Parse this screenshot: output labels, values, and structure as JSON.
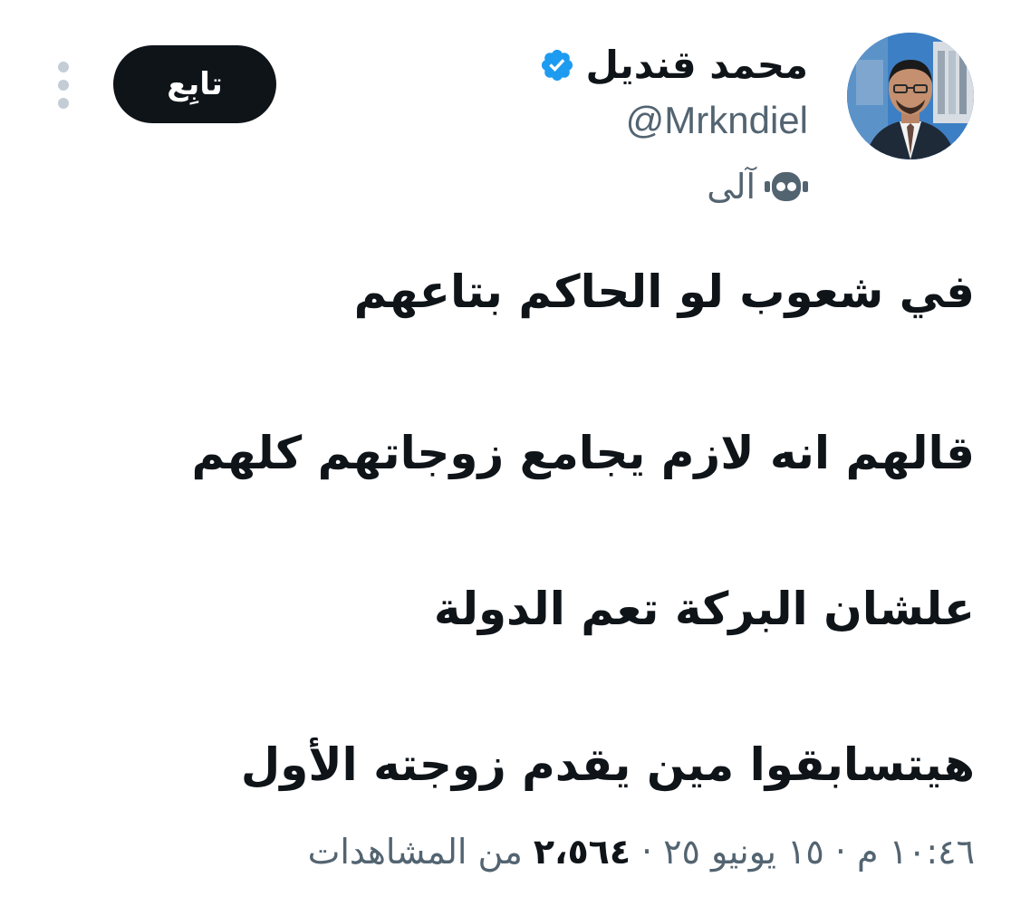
{
  "author": {
    "name": "محمد قنديل",
    "handle": "@Mrkndiel",
    "automated_label": "آلى",
    "verified_badge_color": "#1d9bf0"
  },
  "follow_button": {
    "label": "تابِع"
  },
  "tweet": {
    "lines": [
      "في شعوب لو الحاكم بتاعهم",
      "قالهم انه لازم يجامع زوجاتهم كلهم",
      "علشان البركة تعم الدولة",
      "هيتسابقوا مين يقدم زوجته الأول"
    ]
  },
  "meta": {
    "time": "١٠:٤٦ م",
    "separator": "·",
    "date": "١٥ يونيو ٢٥",
    "views_count": "٢،٥٦٤",
    "views_label": "من المشاهدات"
  },
  "icons": {
    "verified": "verified-badge-icon",
    "automated": "robot-icon",
    "more": "more-vertical-icon"
  },
  "colors": {
    "text_primary": "#0f1419",
    "text_secondary": "#536471",
    "button_bg": "#0f1419",
    "button_text": "#ffffff"
  }
}
